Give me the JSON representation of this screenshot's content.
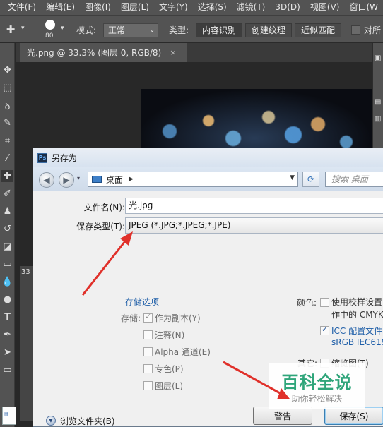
{
  "menubar": {
    "items": [
      "文件(F)",
      "编辑(E)",
      "图像(I)",
      "图层(L)",
      "文字(Y)",
      "选择(S)",
      "滤镜(T)",
      "3D(D)",
      "视图(V)",
      "窗口(W"
    ]
  },
  "options": {
    "brush_size": "80",
    "mode_label": "模式:",
    "mode_value": "正常",
    "type_label": "类型:",
    "type_tabs": [
      "内容识别",
      "创建纹理",
      "近似匹配"
    ],
    "sample_label": "对所"
  },
  "document": {
    "tab_title": "光.png @ 33.3% (图层 0, RGB/8)",
    "close_glyph": "×",
    "zoom_fragment": "33"
  },
  "dialog": {
    "title": "另存为",
    "ps_icon_text": "Ps",
    "path_label": "桌面",
    "search_placeholder": "搜索 桌面",
    "filename_label": "文件名(N):",
    "filename_value": "光.jpg",
    "filetype_label": "保存类型(T):",
    "filetype_value": "JPEG (*.JPG;*.JPEG;*.JPE)",
    "save_options_heading": "存储选项",
    "store_label": "存储:",
    "options": [
      {
        "label": "作为副本(Y)",
        "checked": true
      },
      {
        "label": "注释(N)",
        "checked": false
      },
      {
        "label": "Alpha 通道(E)",
        "checked": false
      },
      {
        "label": "专色(P)",
        "checked": false
      },
      {
        "label": "图层(L)",
        "checked": false
      }
    ],
    "color_label": "颜色:",
    "proof_line1": "使用校样设置(",
    "proof_line2": "作中的 CMYK",
    "icc_line1": "ICC 配置文件(",
    "icc_line2": "sRGB IEC619",
    "other_label": "其它:",
    "thumbnail_label": "缩览图(T)",
    "browse_label": "浏览文件夹(B)",
    "warning_button": "警告",
    "save_button": "保存(S)"
  },
  "watermark": {
    "title": "百科全说",
    "subtitle": "助你轻松解决"
  },
  "colors": {
    "ps_chrome": "#535353",
    "dialog_bg": "#f0f0f0",
    "link_blue": "#1e5ea8",
    "arrow_red": "#e0302a",
    "watermark_green": "#2fa57a"
  }
}
